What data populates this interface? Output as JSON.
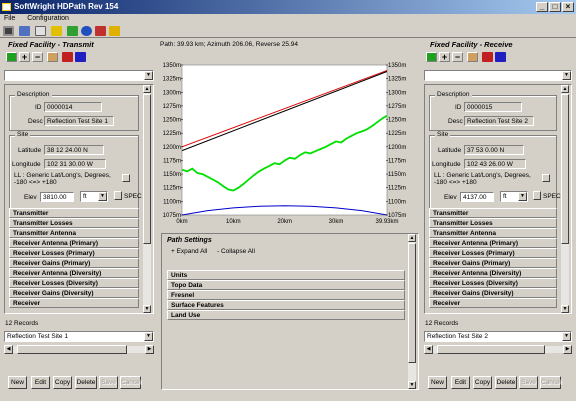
{
  "app": {
    "title": "SoftWright HDPath Rev 154",
    "menu": [
      "File",
      "Configuration"
    ]
  },
  "header": {
    "path_info": "Path: 39.93 km; Azimuth 206.06, Reverse 25.94"
  },
  "left": {
    "panel_title": "Fixed Facility - Transmit",
    "description_group": "Description",
    "id_label": "ID",
    "id_value": "0000014",
    "desc_label": "Desc",
    "desc_value": "Reflection Test Site 1",
    "site_group": "Site",
    "latitude_label": "Latitude",
    "latitude_value": "38 12 24.00 N",
    "longitude_label": "Longitude",
    "longitude_value": "102 31 30.00 W",
    "ll_text": "LL : Generic Lat/Long's, Degrees, -180 <=> +180",
    "elev_label": "Elev",
    "elev_value": "3810.00",
    "elev_unit": "ft",
    "spec_label": "SPEC",
    "sections": [
      "Transmitter",
      "Transmitter Losses",
      "Transmitter Antenna",
      "Receiver Antenna (Primary)",
      "Receiver Losses (Primary)",
      "Receiver Gains (Primary)",
      "Receiver Antenna (Diversity)",
      "Receiver Losses (Diversity)",
      "Receiver Gains (Diversity)",
      "Receiver"
    ],
    "records": "12 Records",
    "record_select": "Reflection Test Site 1",
    "buttons": {
      "new": "New",
      "edit": "Edit",
      "copy": "Copy",
      "delete": "Delete",
      "save": "Save",
      "cancel": "Cancel"
    }
  },
  "right": {
    "panel_title": "Fixed Facility - Receive",
    "description_group": "Description",
    "id_label": "ID",
    "id_value": "0000015",
    "desc_label": "Desc",
    "desc_value": "Reflection Test Site 2",
    "site_group": "Site",
    "latitude_label": "Latitude",
    "latitude_value": "37 53 0.00 N",
    "longitude_label": "Longitude",
    "longitude_value": "102 43 26.00 W",
    "ll_text": "LL : Generic Lat/Long's, Degrees, -180 <=> +180",
    "elev_label": "Elev",
    "elev_value": "4137.00",
    "elev_unit": "ft",
    "spec_label": "SPEC",
    "sections": [
      "Transmitter",
      "Transmitter Losses",
      "Transmitter Antenna",
      "Receiver Antenna (Primary)",
      "Receiver Losses (Primary)",
      "Receiver Gains (Primary)",
      "Receiver Antenna (Diversity)",
      "Receiver Losses (Diversity)",
      "Receiver Gains (Diversity)",
      "Receiver"
    ],
    "records": "12 Records",
    "record_select": "Reflection Test Site 2",
    "buttons": {
      "new": "New",
      "edit": "Edit",
      "copy": "Copy",
      "delete": "Delete",
      "save": "Save",
      "cancel": "Cancel"
    }
  },
  "path_settings": {
    "title": "Path Settings",
    "expand_all": "+ Expand All",
    "collapse_all": "- Collapse All",
    "sections": [
      "Units",
      "Topo Data",
      "Fresnel",
      "Surface Features",
      "Land Use"
    ]
  },
  "colors": {
    "terrain": "#00e000",
    "direct_path": "#e00000",
    "sightline": "#000000",
    "earth_bulge": "#0000cc"
  },
  "chart_data": {
    "type": "line",
    "title": "",
    "xlabel": "",
    "ylabel": "",
    "x_ticks": [
      "0km",
      "10km",
      "20km",
      "30km",
      "39.93km"
    ],
    "y_ticks": [
      "1350m",
      "1325m",
      "1300m",
      "1275m",
      "1250m",
      "1225m",
      "1200m",
      "1175m",
      "1150m",
      "1125m",
      "1100m",
      "1075m"
    ],
    "xlim": [
      0,
      39.93
    ],
    "ylim": [
      1075,
      1350
    ],
    "grid": false,
    "series": [
      {
        "role": "direct_path",
        "x": [
          0,
          39.93
        ],
        "y": [
          1200,
          1340
        ]
      },
      {
        "role": "sightline",
        "x": [
          0,
          39.93
        ],
        "y": [
          1193,
          1338
        ]
      },
      {
        "role": "earth_bulge",
        "x": [
          0,
          5,
          10,
          15,
          20,
          25,
          30,
          35,
          39.93
        ],
        "y": [
          1075,
          1083,
          1088,
          1091,
          1092,
          1091,
          1088,
          1083,
          1075
        ]
      },
      {
        "role": "terrain",
        "x": [
          0,
          1,
          2,
          3,
          4,
          5,
          6,
          7,
          8,
          9,
          10,
          11,
          12,
          13,
          14,
          15,
          16,
          17,
          18,
          19,
          20,
          21,
          22,
          23,
          24,
          25,
          26,
          27,
          28,
          29,
          30,
          31,
          32,
          33,
          34,
          35,
          36,
          37,
          38,
          39,
          39.93
        ],
        "y": [
          1158,
          1155,
          1160,
          1152,
          1150,
          1145,
          1140,
          1135,
          1128,
          1122,
          1120,
          1125,
          1132,
          1140,
          1148,
          1155,
          1160,
          1165,
          1170,
          1168,
          1175,
          1180,
          1178,
          1185,
          1190,
          1188,
          1192,
          1196,
          1200,
          1205,
          1210,
          1208,
          1215,
          1220,
          1225,
          1228,
          1232,
          1238,
          1245,
          1252,
          1257
        ]
      }
    ]
  }
}
